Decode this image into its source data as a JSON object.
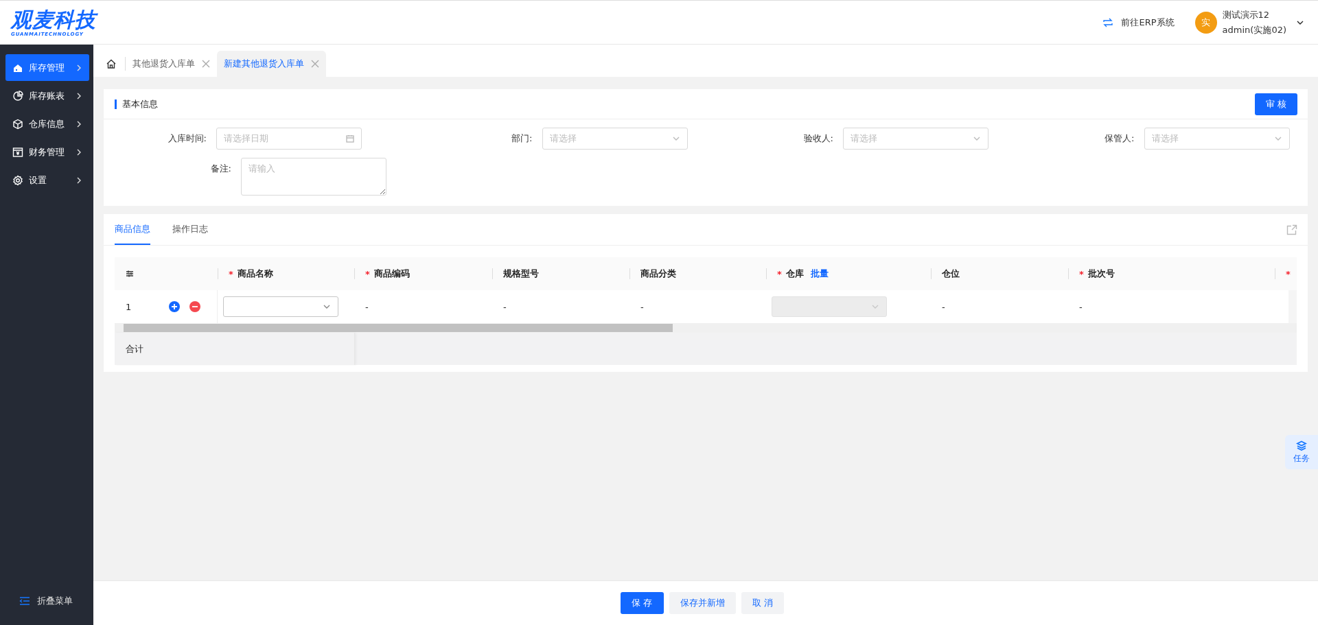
{
  "header": {
    "logo": "观麦科技",
    "logo_sub": "GUANMAITECHNOLOGY",
    "erp_link": "前往ERP系统",
    "avatar": "实",
    "user_name": "测试演示12",
    "user_account": "admin(实施02)"
  },
  "sidebar": {
    "items": [
      {
        "label": "库存管理",
        "selected": true
      },
      {
        "label": "库存账表",
        "selected": false
      },
      {
        "label": "仓库信息",
        "selected": false
      },
      {
        "label": "财务管理",
        "selected": false
      },
      {
        "label": "设置",
        "selected": false
      }
    ],
    "collapse": "折叠菜单"
  },
  "page_tabs": [
    {
      "label": "其他退货入库单",
      "selected": false
    },
    {
      "label": "新建其他退货入库单",
      "selected": true
    }
  ],
  "basic_info": {
    "title": "基本信息",
    "audit_button": "审 核",
    "fields": [
      {
        "label": "入库时间:",
        "kind": "date",
        "placeholder": "请选择日期"
      },
      {
        "label": "部门:",
        "kind": "select",
        "placeholder": "请选择"
      },
      {
        "label": "验收人:",
        "kind": "select",
        "placeholder": "请选择"
      },
      {
        "label": "保管人:",
        "kind": "select",
        "placeholder": "请选择"
      },
      {
        "label": "备注:",
        "kind": "textarea",
        "placeholder": "请输入"
      }
    ]
  },
  "goods": {
    "tabs": [
      {
        "label": "商品信息",
        "selected": true
      },
      {
        "label": "操作日志",
        "selected": false
      }
    ],
    "table": {
      "columns": [
        {
          "kind": "settings"
        },
        {
          "kind": "text",
          "mark": "*",
          "label": "商品名称"
        },
        {
          "kind": "text",
          "mark": "*",
          "label": "商品编码"
        },
        {
          "kind": "text",
          "label": "规格型号"
        },
        {
          "kind": "text",
          "label": "商品分类"
        },
        {
          "kind": "text",
          "mark": "*",
          "label": "仓库",
          "link": "批量"
        },
        {
          "kind": "text",
          "label": "仓位"
        },
        {
          "kind": "text",
          "mark": "*",
          "label": "批次号"
        },
        {
          "kind": "text",
          "mark": "*"
        }
      ],
      "rows": [
        {
          "cells": [
            {
              "kind": "index",
              "text": "1"
            },
            {
              "kind": "select",
              "disabled": false
            },
            {
              "kind": "text",
              "text": "-"
            },
            {
              "kind": "text",
              "text": "-"
            },
            {
              "kind": "text",
              "text": "-"
            },
            {
              "kind": "select",
              "disabled": true
            },
            {
              "kind": "text",
              "text": "-"
            },
            {
              "kind": "text",
              "text": "-"
            }
          ]
        }
      ],
      "footer": "合计"
    }
  },
  "actions": [
    {
      "label": "保 存",
      "primary": true
    },
    {
      "label": "保存并新增",
      "primary": false
    },
    {
      "label": "取 消",
      "primary": false
    }
  ],
  "task_button": "任务"
}
